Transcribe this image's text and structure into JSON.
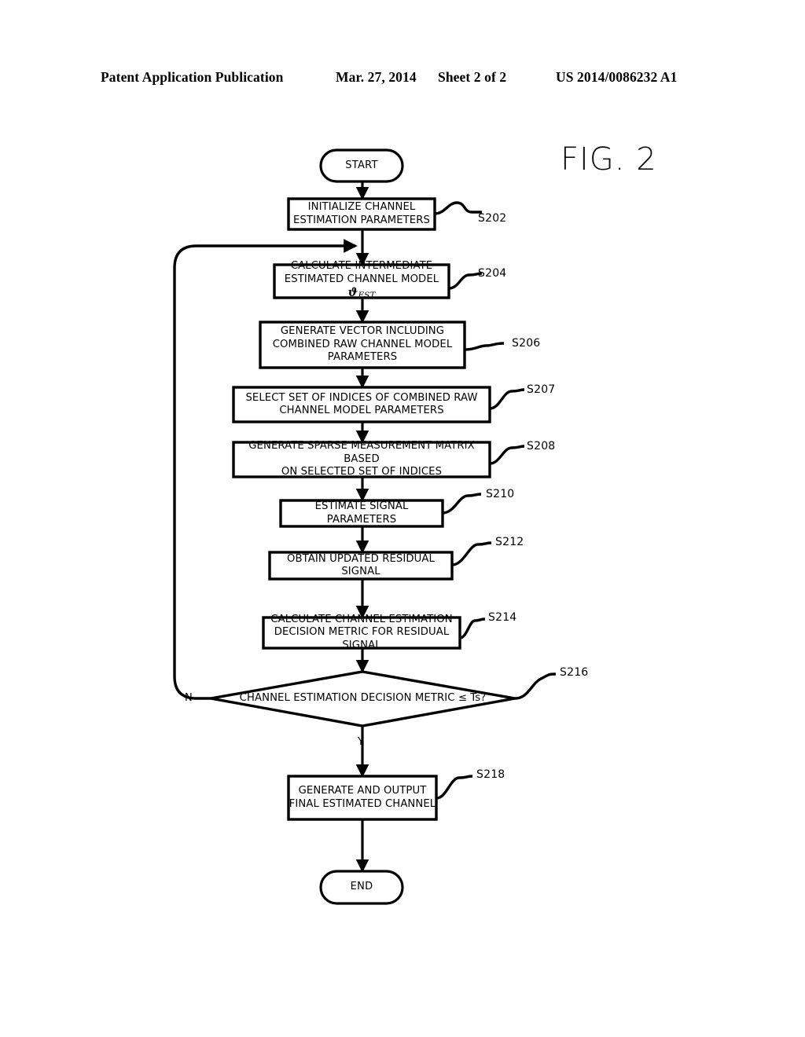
{
  "header": {
    "publication": "Patent Application Publication",
    "date": "Mar. 27, 2014",
    "sheet": "Sheet 2 of 2",
    "patent_number": "US 2014/0086232 A1"
  },
  "figure": {
    "label": "FIG. 2"
  },
  "flowchart": {
    "nodes": {
      "start": {
        "text": "START",
        "shape": "terminal"
      },
      "s202": {
        "text": "INITIALIZE CHANNEL\nESTIMATION PARAMETERS",
        "shape": "process",
        "step": "S202"
      },
      "s204": {
        "text": "CALCULATE INTERMEDIATE\nESTIMATED CHANNEL MODEL ",
        "text_suffix_symbol": "ϑ",
        "text_suffix_sub": "EST",
        "shape": "process",
        "step": "S204"
      },
      "s206": {
        "text": "GENERATE VECTOR INCLUDING\nCOMBINED RAW CHANNEL MODEL\nPARAMETERS",
        "shape": "process",
        "step": "S206"
      },
      "s207": {
        "text": "SELECT SET OF INDICES OF COMBINED RAW\nCHANNEL MODEL PARAMETERS",
        "shape": "process",
        "step": "S207"
      },
      "s208": {
        "text": "GENERATE SPARSE MEASUREMENT MATRIX BASED\nON SELECTED SET OF INDICES",
        "shape": "process",
        "step": "S208"
      },
      "s210": {
        "text": "ESTIMATE SIGNAL PARAMETERS",
        "shape": "process",
        "step": "S210"
      },
      "s212": {
        "text": "OBTAIN UPDATED RESIDUAL SIGNAL",
        "shape": "process",
        "step": "S212"
      },
      "s214": {
        "text": "CALCULATE CHANNEL ESTIMATION\nDECISION METRIC FOR RESIDUAL SIGNAL",
        "shape": "process",
        "step": "S214"
      },
      "s216": {
        "text": "CHANNEL ESTIMATION DECISION METRIC ≤  Ts?",
        "shape": "decision",
        "step": "S216"
      },
      "s218": {
        "text": "GENERATE AND OUTPUT\nFINAL ESTIMATED CHANNEL",
        "shape": "process",
        "step": "S218"
      },
      "end": {
        "text": "END",
        "shape": "terminal"
      }
    },
    "branch_labels": {
      "no": "N",
      "yes": "Y"
    },
    "colors": {
      "stroke": "#000000",
      "fill": "#ffffff",
      "text": "#000000"
    }
  }
}
